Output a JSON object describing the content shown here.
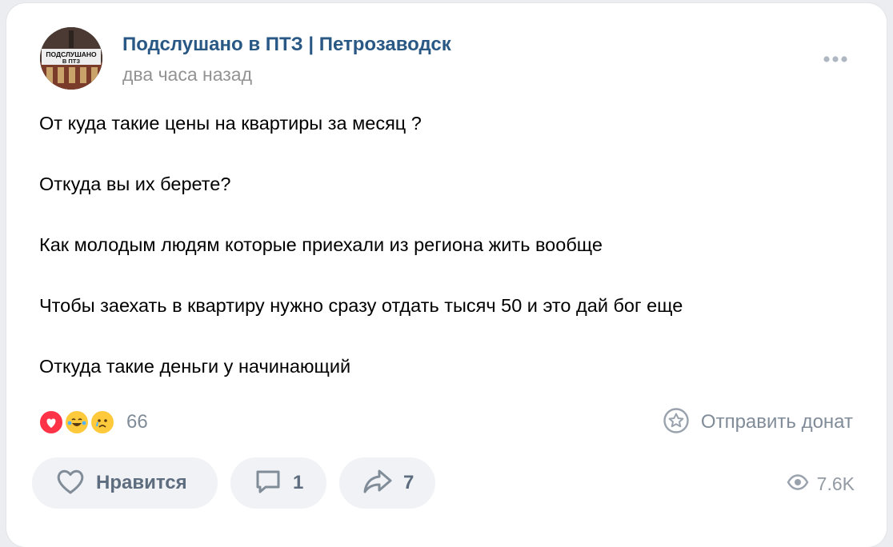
{
  "post": {
    "group_name": "Подслушано в ПТЗ | Петрозаводск",
    "time": "два часа назад",
    "avatar_text_line1": "ПОДСЛУШАНО",
    "avatar_text_line2": "В ПТЗ",
    "lines": [
      "От куда такие цены на квартиры за месяц ?",
      "Откуда вы их берете?",
      "Как молодым людям которые приехали из региона жить вообще",
      "Чтобы заехать в квартиру нужно сразу отдать тысяч 50 и это дай бог еще",
      "Откуда такие деньги у начинающий"
    ]
  },
  "reactions": {
    "icons": [
      "heart-icon",
      "laughing-tears-icon",
      "crying-face-icon"
    ],
    "count": "66"
  },
  "donate": {
    "label": "Отправить донат",
    "icon": "star-badge-icon"
  },
  "actions": {
    "like_label": "Нравится",
    "comment_count": "1",
    "share_count": "7"
  },
  "views": {
    "count": "7.6K",
    "icon": "eye-icon"
  },
  "colors": {
    "link": "#2a5885",
    "muted": "#818c99",
    "button_bg": "#f0f2f5",
    "heart": "#ff3347",
    "emoji": "#ffc93c"
  }
}
